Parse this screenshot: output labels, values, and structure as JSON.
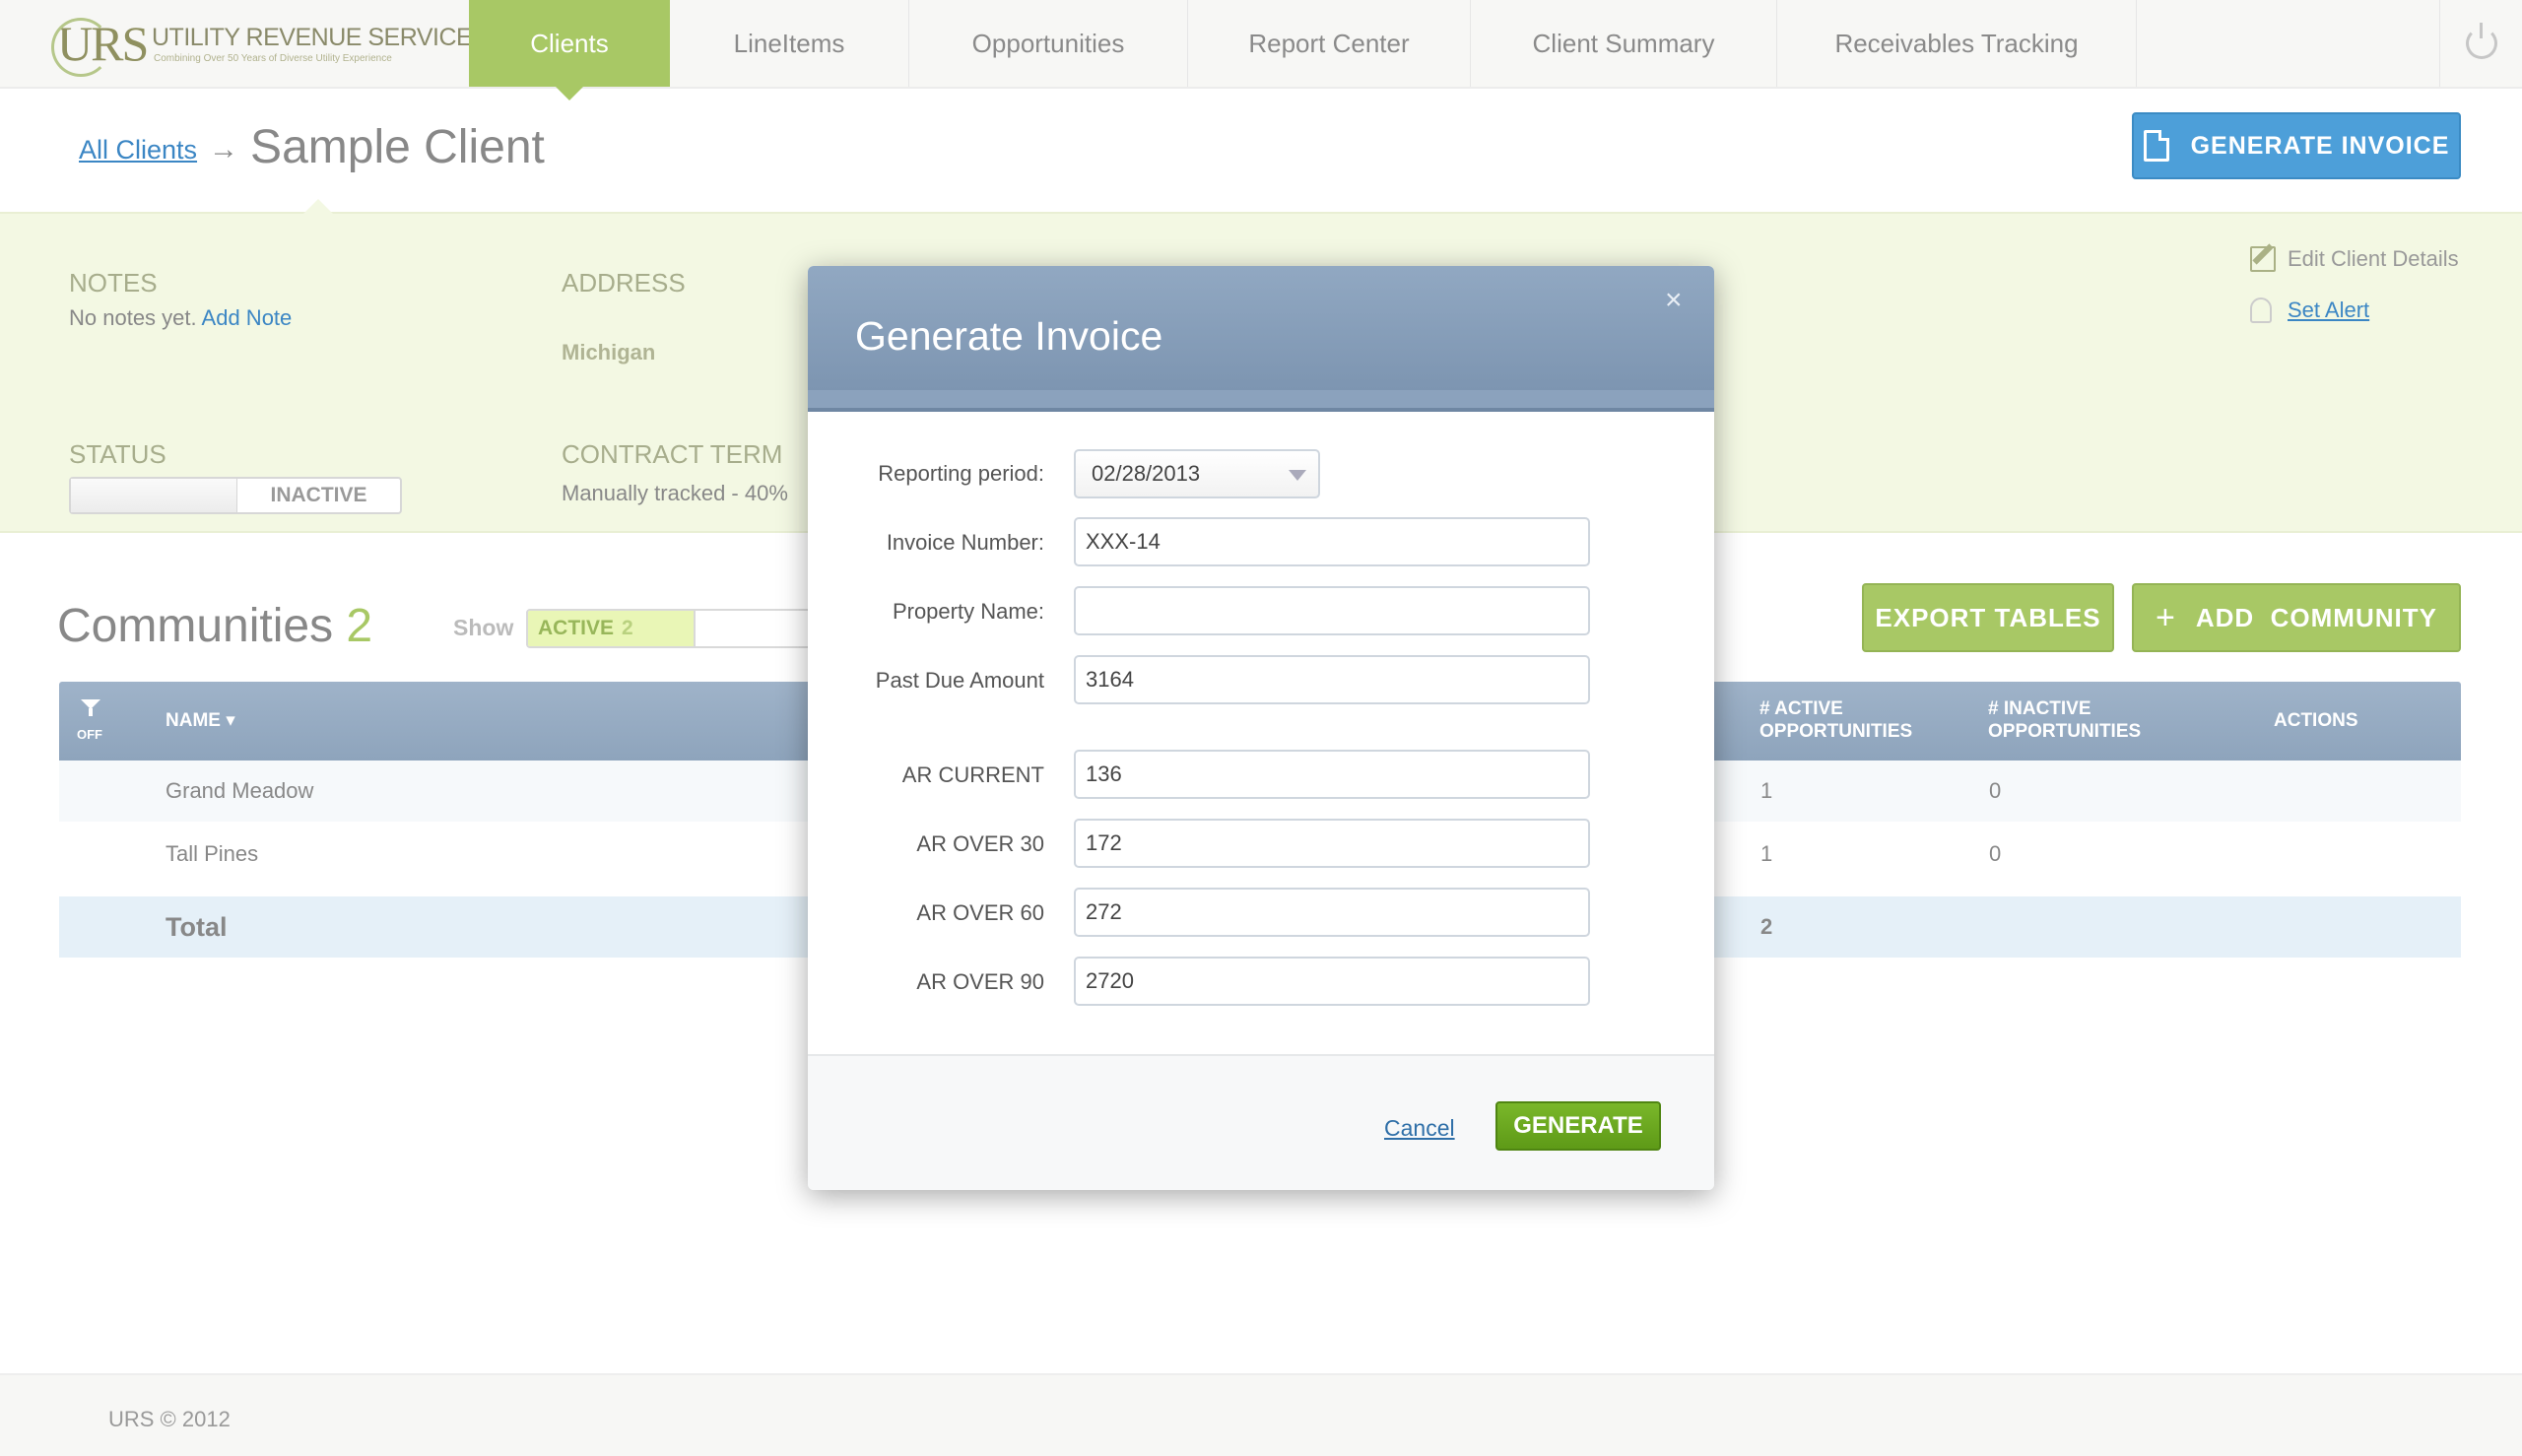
{
  "logo": {
    "mark": "URS",
    "name": "UTILITY REVENUE SERVICES",
    "tagline": "Combining Over 50 Years of Diverse Utility Experience"
  },
  "nav": {
    "items": [
      {
        "label": "Clients",
        "active": true
      },
      {
        "label": "LineItems"
      },
      {
        "label": "Opportunities"
      },
      {
        "label": "Report Center"
      },
      {
        "label": "Client Summary"
      },
      {
        "label": "Receivables Tracking"
      }
    ]
  },
  "header": {
    "breadcrumb_link": "All Clients",
    "arrow": "→",
    "title": "Sample Client",
    "generate_invoice_label": "GENERATE INVOICE"
  },
  "client": {
    "notes_label": "NOTES",
    "notes_text": "No notes yet.",
    "add_note_label": "Add Note",
    "address_label": "ADDRESS",
    "address_value": "Michigan",
    "status_label": "STATUS",
    "status_value": "INACTIVE",
    "contract_label": "CONTRACT TERM",
    "contract_value": "Manually tracked - 40%",
    "edit_details_label": "Edit Client Details",
    "set_alert_label": "Set Alert"
  },
  "communities": {
    "title": "Communities",
    "count": "2",
    "show_label": "Show",
    "show_active": "ACTIVE",
    "show_active_count": "2",
    "export_label": "EXPORT TABLES",
    "add_label": "ADD  COMMUNITY",
    "filter_off": "OFF",
    "columns": {
      "name": "NAME ▾",
      "active_opps_1": "# ACTIVE",
      "active_opps_2": "OPPORTUNITIES",
      "inactive_opps_1": "# INACTIVE",
      "inactive_opps_2": "OPPORTUNITIES",
      "actions": "ACTIONS"
    },
    "rows": [
      {
        "name": "Grand Meadow",
        "active": "1",
        "inactive": "0"
      },
      {
        "name": "Tall Pines",
        "active": "1",
        "inactive": "0"
      }
    ],
    "total": {
      "label": "Total",
      "active": "2"
    }
  },
  "modal": {
    "title": "Generate Invoice",
    "close": "×",
    "fields": {
      "reporting_period_label": "Reporting period:",
      "reporting_period_value": "02/28/2013",
      "invoice_number_label": "Invoice Number:",
      "invoice_number_value": "XXX-14",
      "property_name_label": "Property Name:",
      "property_name_value": "",
      "past_due_label": "Past Due Amount",
      "past_due_value": "3164",
      "ar_current_label": "AR CURRENT",
      "ar_current_value": "136",
      "ar_30_label": "AR OVER 30",
      "ar_30_value": "172",
      "ar_60_label": "AR OVER 60",
      "ar_60_value": "272",
      "ar_90_label": "AR OVER 90",
      "ar_90_value": "2720"
    },
    "cancel_label": "Cancel",
    "generate_label": "GENERATE"
  },
  "footer": {
    "copyright": "URS © 2012"
  },
  "colors": {
    "accent_green": "#a8c865",
    "accent_blue": "#4d9fd9",
    "generate_green": "#6aa81f",
    "table_header": "#95aac2"
  }
}
